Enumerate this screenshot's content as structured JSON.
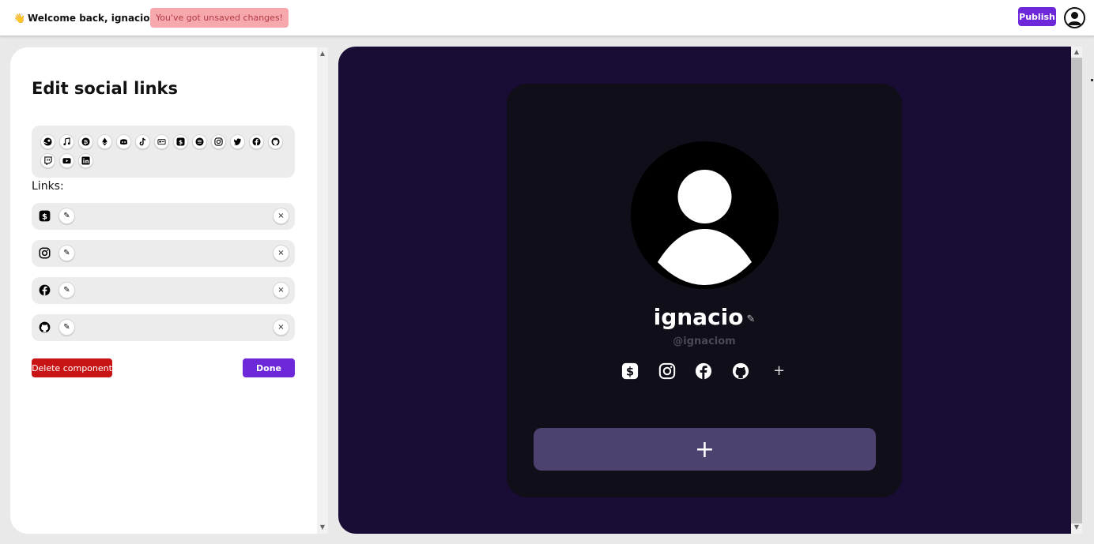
{
  "topbar": {
    "wave_emoji": "👋",
    "welcome_text": "Welcome back, ignacio!",
    "unsaved_text": "You've got unsaved changes!",
    "publish_label": "Publish",
    "avatar_icon": "user-avatar-icon"
  },
  "editor": {
    "heading": "Edit social links",
    "icon_picker": [
      "steam",
      "apple-music",
      "bitcoin",
      "ethereum",
      "discord",
      "tiktok",
      "cash-card",
      "cash-app",
      "spotify",
      "instagram",
      "twitter",
      "facebook",
      "github",
      "twitch",
      "youtube",
      "linkedin"
    ],
    "links_label": "Links:",
    "links": [
      {
        "icon": "cash-app-icon"
      },
      {
        "icon": "instagram-icon"
      },
      {
        "icon": "facebook-icon"
      },
      {
        "icon": "github-icon"
      }
    ],
    "edit_glyph": "✎",
    "remove_glyph": "×",
    "delete_label": "Delete component",
    "done_label": "Done"
  },
  "preview": {
    "name": "ignacio",
    "name_edit_glyph": "✎",
    "handle": "@ignaciom",
    "social_icons": [
      "cash-app-icon",
      "instagram-icon",
      "facebook-icon",
      "github-icon"
    ],
    "add_social_glyph": "+",
    "add_block_glyph": "+"
  },
  "colors": {
    "accent": "#6d28d9",
    "danger": "#c81414",
    "unsaved_bg": "#f7a8ad",
    "preview_bg": "#190d36",
    "card_bg": "#100e19",
    "add_block_bg": "#4d4170"
  }
}
